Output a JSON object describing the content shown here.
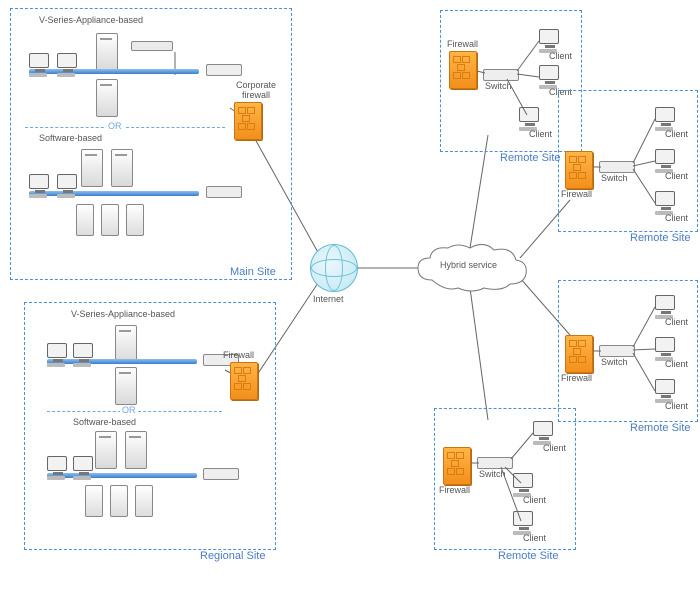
{
  "main_site": {
    "title": "Main Site",
    "top_group_label": "V-Series-Appliance-based",
    "or_label": "OR",
    "bottom_group_label": "Software-based",
    "corp_firewall_label": "Corporate\nfirewall"
  },
  "regional_site": {
    "title": "Regional Site",
    "top_group_label": "V-Series-Appliance-based",
    "or_label": "OR",
    "bottom_group_label": "Software-based",
    "firewall_label": "Firewall"
  },
  "center": {
    "internet_label": "Internet",
    "hybrid_label": "Hybrid service"
  },
  "remote_sites": [
    {
      "title": "Remote Site",
      "firewall": "Firewall",
      "switch": "Switch",
      "clients": [
        "Client",
        "Client",
        "Client"
      ]
    },
    {
      "title": "Remote Site",
      "firewall": "Firewall",
      "switch": "Switch",
      "clients": [
        "Client",
        "Client",
        "Client"
      ]
    },
    {
      "title": "Remote Site",
      "firewall": "Firewall",
      "switch": "Switch",
      "clients": [
        "Client",
        "Client",
        "Client"
      ]
    },
    {
      "title": "Remote Site",
      "firewall": "Firewall",
      "switch": "Switch",
      "clients": [
        "Client",
        "Client",
        "Client"
      ]
    }
  ]
}
